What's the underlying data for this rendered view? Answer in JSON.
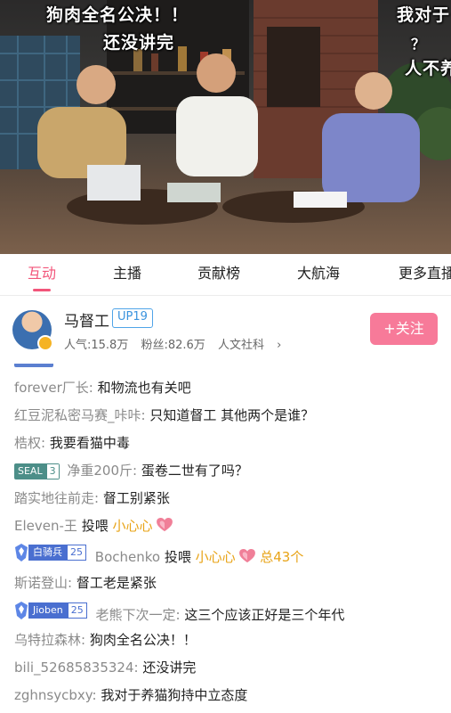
{
  "danmaku": [
    "狗肉全名公决！！",
    "还没讲完",
    "我对于",
    "？",
    "人不养"
  ],
  "tabs": [
    {
      "label": "互动",
      "active": true
    },
    {
      "label": "主播",
      "active": false
    },
    {
      "label": "贡献榜",
      "active": false
    },
    {
      "label": "大航海",
      "active": false
    },
    {
      "label": "更多直播",
      "active": false
    }
  ],
  "streamer": {
    "name": "马督工",
    "up_level": "UP19",
    "popularity": "人气:15.8万",
    "fans": "粉丝:82.6万",
    "category": "人文社科",
    "follow_label": "+关注"
  },
  "chat": [
    {
      "user": "forever厂长:",
      "text": "和物流也有关吧"
    },
    {
      "user": "红豆泥私密马赛_咔咔:",
      "text": "只知道督工  其他两个是谁？"
    },
    {
      "user": "梏权:",
      "text": "我要看猫中毒"
    },
    {
      "medal": {
        "name": "SEAL",
        "level": "3"
      },
      "user": "净重200斤:",
      "text": "蛋卷二世有了吗？"
    },
    {
      "user": "踏实地往前走:",
      "text": "督工别紧张"
    },
    {
      "user": "Eleven-王",
      "text": "投喂",
      "gift": "小心心"
    },
    {
      "guard": {
        "name": "白骑兵",
        "level": "25"
      },
      "user": "Bochenko",
      "text": "投喂",
      "gift": "小心心",
      "total": "总43个"
    },
    {
      "user": "斯诺登山:",
      "text": "督工老是紧张"
    },
    {
      "guard": {
        "name": "Jioben",
        "level": "25"
      },
      "user": "老熊下次一定:",
      "text": "这三个应该正好是三个年代"
    },
    {
      "user": "乌特拉森林:",
      "text": "狗肉全名公决！！"
    },
    {
      "user": "bili_52685835324:",
      "text": "还没讲完"
    },
    {
      "user": "zghnsycbxy:",
      "text": "我对于养猫狗持中立态度"
    }
  ],
  "colors": {
    "accent": "#f2557a",
    "follow": "#f77a99",
    "gift": "#e8a316",
    "up_badge": "#3a93de"
  }
}
